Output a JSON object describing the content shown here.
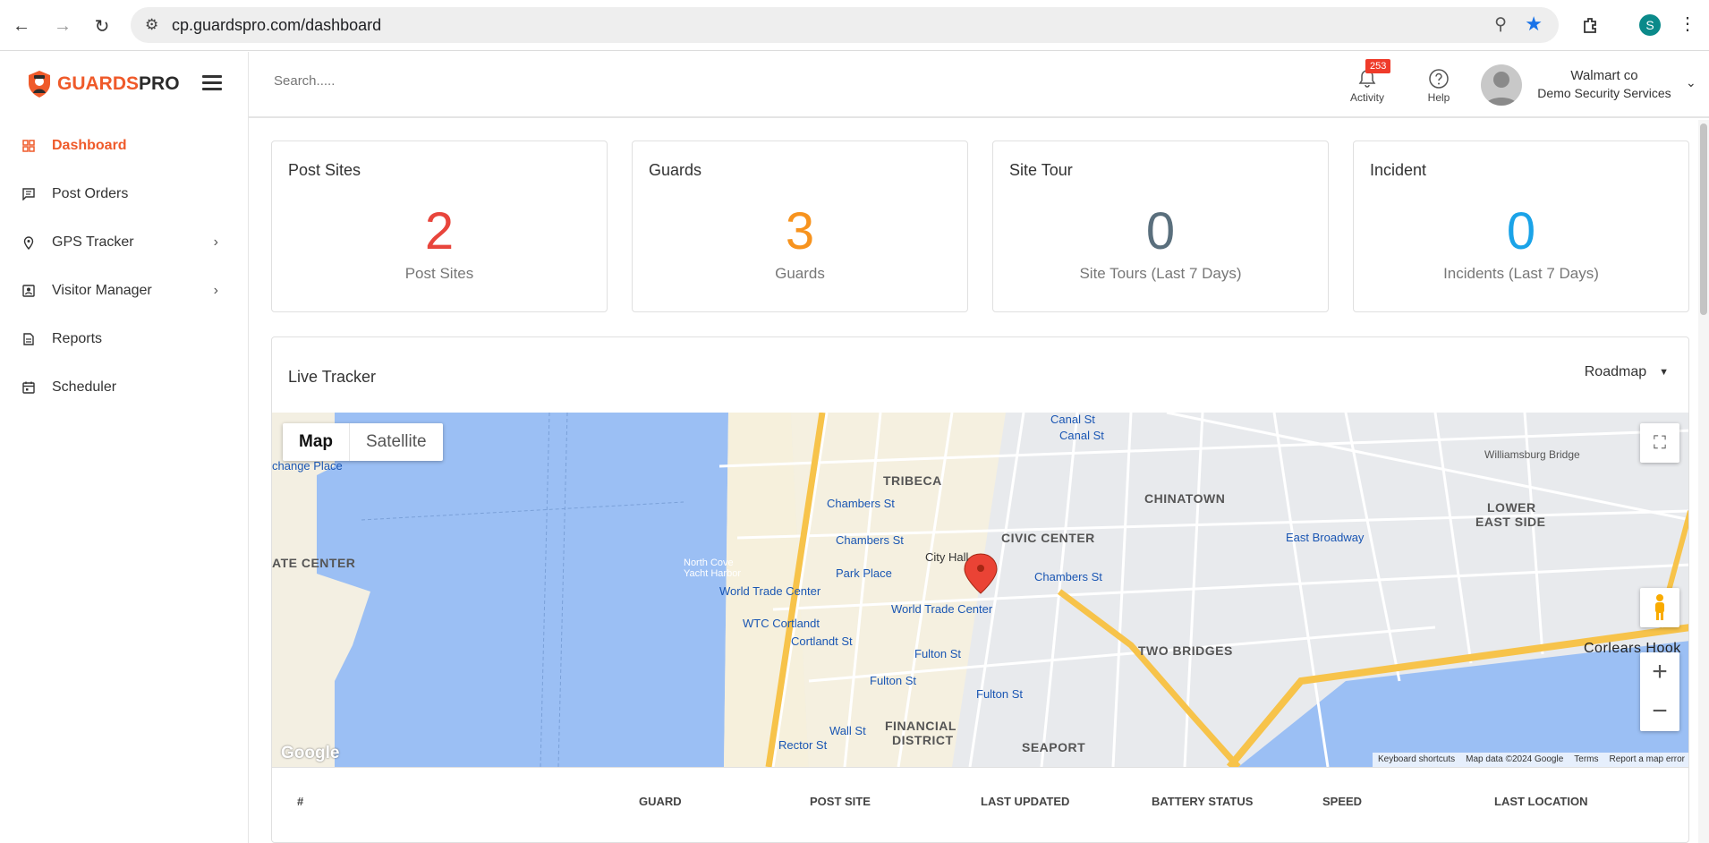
{
  "browser": {
    "url": "cp.guardspro.com/dashboard",
    "profile_initial": "S"
  },
  "brand": {
    "part1": "GUARDS",
    "part2": "PRO"
  },
  "sidebar": {
    "items": [
      {
        "label": "Dashboard",
        "active": true
      },
      {
        "label": "Post Orders"
      },
      {
        "label": "GPS Tracker",
        "has_submenu": true
      },
      {
        "label": "Visitor Manager",
        "has_submenu": true
      },
      {
        "label": "Reports"
      },
      {
        "label": "Scheduler"
      }
    ]
  },
  "header": {
    "search_placeholder": "Search.....",
    "activity_label": "Activity",
    "activity_count": "253",
    "help_label": "Help",
    "user_name": "Walmart co",
    "user_org": "Demo Security Services"
  },
  "cards": [
    {
      "title": "Post Sites",
      "value": "2",
      "subtitle": "Post Sites",
      "color": "#e8453c"
    },
    {
      "title": "Guards",
      "value": "3",
      "subtitle": "Guards",
      "color": "#f7931e"
    },
    {
      "title": "Site Tour",
      "value": "0",
      "subtitle": "Site Tours (Last 7 Days)",
      "color": "#5a6f7d"
    },
    {
      "title": "Incident",
      "value": "0",
      "subtitle": "Incidents (Last 7 Days)",
      "color": "#1aa3e8"
    }
  ],
  "tracker": {
    "title": "Live Tracker",
    "map_type": "Roadmap",
    "map_tabs": [
      "Map",
      "Satellite"
    ],
    "map_labels": {
      "tribeca": "TRIBECA",
      "chinatown": "CHINATOWN",
      "civic_center": "CIVIC CENTER",
      "lower_east_side_1": "LOWER",
      "lower_east_side_2": "EAST SIDE",
      "two_bridges": "TWO BRIDGES",
      "financial_1": "FINANCIAL",
      "financial_2": "DISTRICT",
      "seaport": "SEAPORT",
      "ate_center": "ATE CENTER",
      "chambers_1": "Chambers St",
      "chambers_2": "Chambers St",
      "chambers_3": "Chambers St",
      "park_place": "Park Place",
      "wtc": "World Trade Center",
      "wtc2": "World Trade Center",
      "wtc_cortlandt": "WTC Cortlandt",
      "cortlandt": "Cortlandt St",
      "fulton_1": "Fulton St",
      "fulton_2": "Fulton St",
      "fulton_3": "Fulton St",
      "wall_st": "Wall St",
      "rector": "Rector St",
      "east_broadway": "East Broadway",
      "canal_1": "Canal St",
      "canal_2": "Canal St",
      "city_hall": "City Hall",
      "corlears": "Corlears Hook",
      "exchange": "change Place",
      "williamsburg": "Williamsburg Bridge",
      "yacht": "North Cove Yacht Harbor"
    },
    "map_footer": [
      "Keyboard shortcuts",
      "Map data ©2024 Google",
      "Terms",
      "Report a map error"
    ],
    "google_logo": "Google",
    "columns": [
      "#",
      "GUARD",
      "POST SITE",
      "LAST UPDATED",
      "BATTERY STATUS",
      "SPEED",
      "LAST LOCATION"
    ]
  }
}
